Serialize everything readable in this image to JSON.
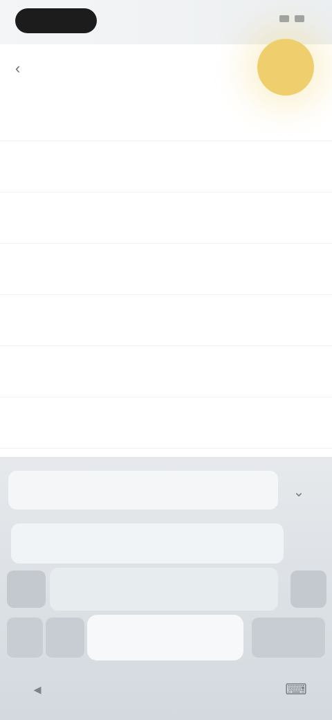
{
  "status_bar": {
    "pill_text": ""
  },
  "header": {
    "back_icon": "back-arrow-icon",
    "title": ""
  },
  "accent_colors": {
    "yellow": "#efcf6d",
    "keyboard_bg": "#d8dee3"
  },
  "list": {
    "items": [
      {
        "title": "",
        "subtitle": ""
      },
      {
        "title": "",
        "subtitle": ""
      },
      {
        "title": "",
        "subtitle": ""
      },
      {
        "title": "",
        "subtitle": ""
      },
      {
        "title": "",
        "subtitle": ""
      },
      {
        "title": "",
        "subtitle": ""
      },
      {
        "title": "",
        "subtitle": ""
      }
    ]
  },
  "keyboard": {
    "suggestions_row": [
      "",
      "",
      ""
    ],
    "second_row": [
      "",
      "",
      ""
    ],
    "space_label": "",
    "collapse_icon": "chevron-down-icon"
  },
  "nav_bar": {
    "left_icon": "back-icon",
    "right_icon": "keyboard-icon"
  }
}
